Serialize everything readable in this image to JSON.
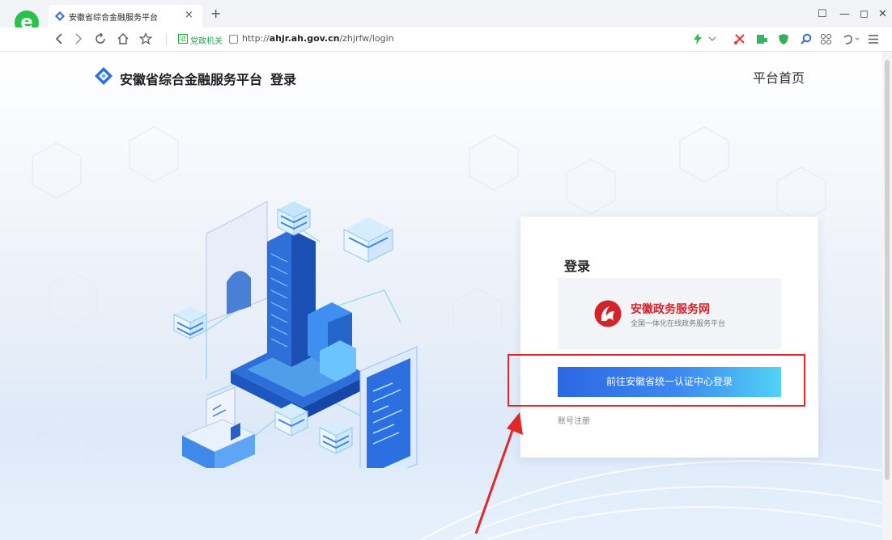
{
  "browser": {
    "logo_glyph": "e",
    "tab_title": "安徽省综合金融服务平台",
    "tab_close": "×",
    "new_tab": "+",
    "window_controls": [
      "☐",
      "—",
      "◻",
      "✕"
    ],
    "cert_badge": "证",
    "cert_label": "党政机关",
    "url_prefix": "http://",
    "url_host": "ahjr.ah.gov.cn",
    "url_path": "/zhjrfw/login",
    "nav_icons": [
      "back-icon",
      "forward-icon",
      "refresh-icon",
      "home-icon",
      "favorite-icon"
    ],
    "toolbar_icons": [
      "lightning-icon",
      "dropdown-icon",
      "scissors-icon",
      "extension-icon",
      "shield-icon",
      "search-icon",
      "apps-icon",
      "undo-icon",
      "menu-icon"
    ],
    "colors": {
      "green": "#27c24c",
      "cert_green": "#22a24a"
    }
  },
  "header": {
    "site_title": "安徽省综合金融服务平台",
    "login_suffix": "登录",
    "home_link": "平台首页"
  },
  "login_card": {
    "title": "登录",
    "gov_name": "安徽政务服务网",
    "gov_tagline": "全国一体化在线政务服务平台",
    "sso_button": "前往安徽省统一认证中心登录",
    "register_link": "账号注册"
  },
  "annotations": {
    "highlight_color": "#e0272a",
    "arrow_color": "#e0272a"
  },
  "colors": {
    "brand_blue": "#2d67e2",
    "brand_cyan": "#52d2f5",
    "gov_red": "#d2232a"
  }
}
